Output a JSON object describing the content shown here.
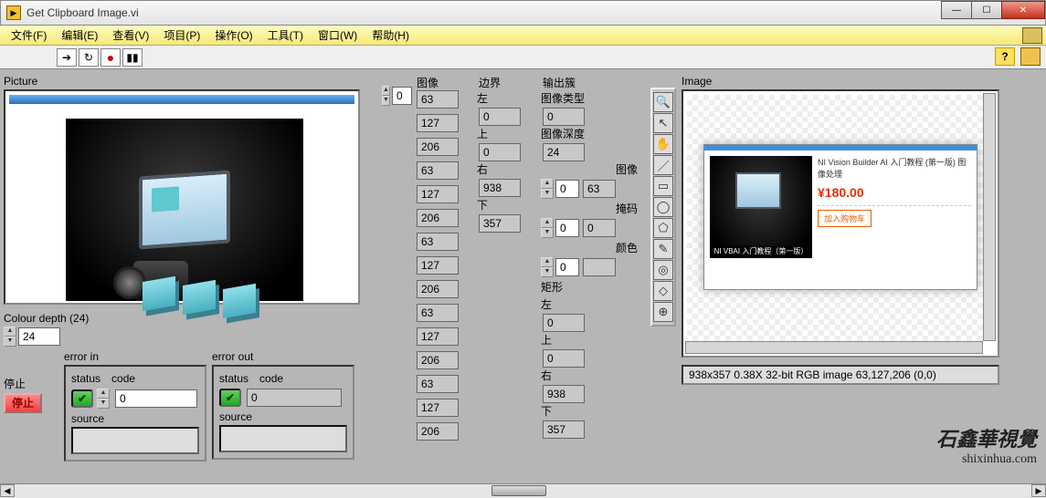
{
  "window": {
    "title": "Get Clipboard Image.vi"
  },
  "menu": {
    "file": "文件(F)",
    "edit": "编辑(E)",
    "view": "查看(V)",
    "project": "项目(P)",
    "operate": "操作(O)",
    "tools": "工具(T)",
    "window": "窗口(W)",
    "help": "帮助(H)"
  },
  "labels": {
    "picture": "Picture",
    "colour_depth": "Colour depth (24)",
    "error_in": "error in",
    "error_out": "error out",
    "status": "status",
    "code": "code",
    "source": "source",
    "stop": "停止",
    "stop_btn": "停止",
    "image_col": "图像",
    "boundary": "边界",
    "left": "左",
    "top": "上",
    "right": "右",
    "bottom": "下",
    "output_cluster": "输出簇",
    "image_type": "图像类型",
    "image_depth": "图像深度",
    "image_sub": "图像",
    "mask": "掩码",
    "color": "颜色",
    "rect": "矩形",
    "image_display": "Image"
  },
  "values": {
    "picture_index": "0",
    "colour_depth": "24",
    "error_in_code": "0",
    "error_out_code": "0",
    "img_list": [
      "63",
      "127",
      "206",
      "63",
      "127",
      "206",
      "63",
      "127",
      "206",
      "63",
      "127",
      "206",
      "63",
      "127",
      "206"
    ],
    "boundary": {
      "left": "0",
      "top": "0",
      "right": "938",
      "bottom": "357"
    },
    "out": {
      "image_type": "0",
      "image_depth": "24",
      "image_spin": "0",
      "image_val": "63",
      "mask_spin": "0",
      "mask_val": "0",
      "color_spin": "0",
      "color_val": "",
      "rect": {
        "left": "0",
        "top": "0",
        "right": "938",
        "bottom": "357"
      }
    },
    "status_line": "938x357 0.38X 32-bit RGB image 63,127,206    (0,0)"
  },
  "product": {
    "title": "NI Vision Builder AI 入门教程 (第一版) 图像处理",
    "price": "¥180.00",
    "caption": "NI VBAI 入门教程（第一版）",
    "button": "加入购物车"
  },
  "watermark": {
    "name": "石鑫華視覺",
    "url": "shixinhua.com"
  }
}
